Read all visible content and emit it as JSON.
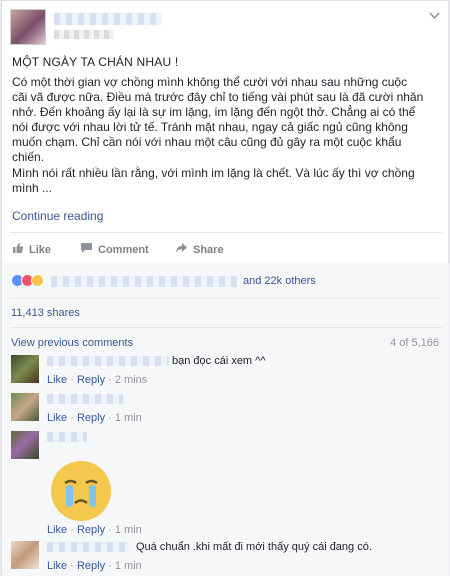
{
  "post": {
    "title": "MỘT NGÀY TA CHÁN NHAU !",
    "body_lines": [
      "Có một thời gian vợ chồng mình không thể cười với nhau sau những cuộc",
      "cãi vã được nữa. Điều mà trước đây chỉ to tiếng vài phút sau là đã cười nhăn",
      "nhở. Đến khoảng ấy lại là sự im lặng, im lặng đến ngột thở. Chẳng ai có thể",
      "nói được với nhau lời tử tế. Tránh mặt nhau, ngay cả giấc ngủ cũng không",
      "muốn chạm. Chỉ cần nói với nhau một câu cũng đủ gây ra một cuộc khẩu",
      "chiến.",
      "Mình nói rất nhiều lần rằng, với mình im lặng là chết. Và lúc ấy thì vợ chồng",
      "mình ..."
    ],
    "continue_label": "Continue reading"
  },
  "actions": {
    "like": "Like",
    "comment": "Comment",
    "share": "Share"
  },
  "feedback": {
    "reactions_others": "and 22k others",
    "shares": "11,413 shares",
    "view_previous": "View previous comments",
    "count": "4 of 5,166"
  },
  "comments": [
    {
      "text": "bạn đọc cái xem ^^",
      "like": "Like",
      "reply": "Reply",
      "time": "2 mins"
    },
    {
      "text": "",
      "like": "Like",
      "reply": "Reply",
      "time": "1 min"
    },
    {
      "text": "",
      "like": "Like",
      "reply": "Reply",
      "time": "1 min"
    },
    {
      "text": "Quá chuẩn .khi mất đi mới thấy quý cái đang có.",
      "like": "Like",
      "reply": "Reply",
      "time": "1 min"
    }
  ],
  "colors": {
    "link": "#365899",
    "muted": "#90949c",
    "like_blue": "#5890ff",
    "love_red": "#f25268"
  },
  "icons": [
    "chevron-down-icon",
    "like-icon",
    "comment-icon",
    "share-icon",
    "sad-sticker-icon"
  ]
}
